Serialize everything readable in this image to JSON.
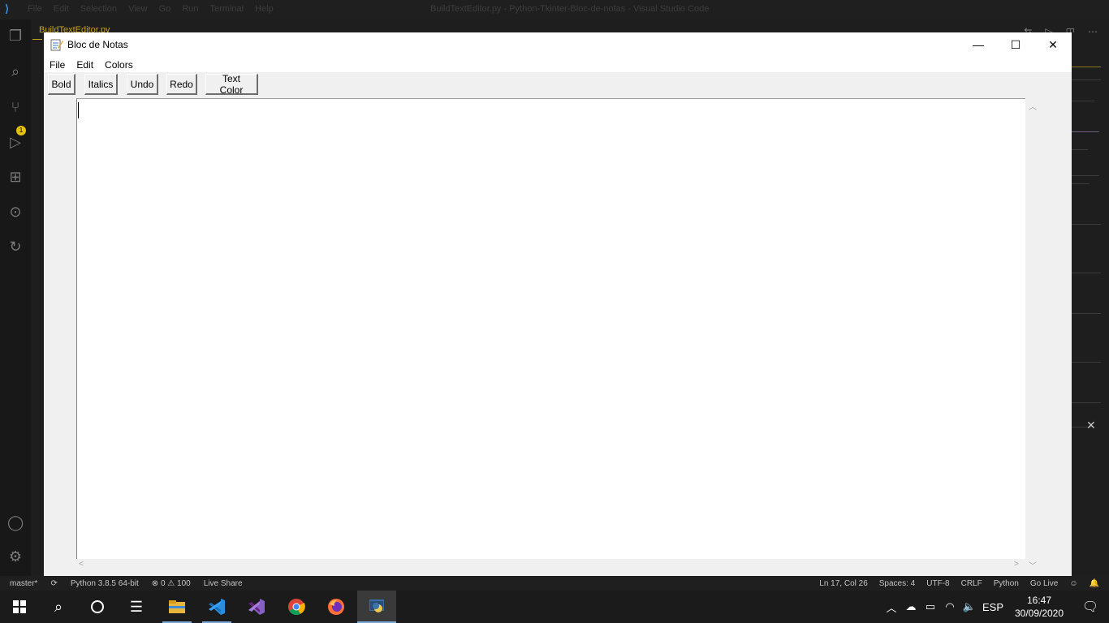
{
  "vscode": {
    "logo": "⟩⟨",
    "menu": [
      "File",
      "Edit",
      "Selection",
      "View",
      "Go",
      "Run",
      "Terminal",
      "Help"
    ],
    "window_title": "BuildTextEditor.py - Python-Tkinter-Bloc-de-notas - Visual Studio Code",
    "tab_label": "BuildTextEditor.py",
    "git_badge": "1"
  },
  "notepad": {
    "title": "Bloc de Notas",
    "menu": {
      "file": "File",
      "edit": "Edit",
      "colors": "Colors"
    },
    "toolbar": {
      "bold": "Bold",
      "italics": "Italics",
      "undo": "Undo",
      "redo": "Redo",
      "text_color": "Text Color"
    },
    "window_controls": {
      "minimize": "—",
      "maximize": "☐",
      "close": "✕"
    }
  },
  "statusbar": {
    "branch": "master*",
    "interpreter": "Python 3.8.5 64-bit",
    "problems": "⊗ 0 ⚠ 100",
    "live_share": "Live Share",
    "position": "Ln 17, Col 26",
    "spaces": "Spaces: 4",
    "encoding": "UTF-8",
    "eol": "CRLF",
    "language": "Python",
    "go_live": "Go Live"
  },
  "taskbar": {
    "language": "ESP",
    "time": "16:47",
    "date": "30/09/2020"
  }
}
